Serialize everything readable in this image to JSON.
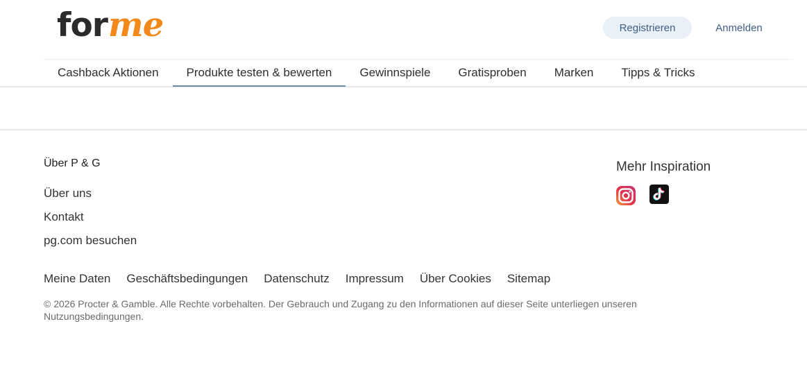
{
  "brand": {
    "logo_part1": "for",
    "logo_part2": "me",
    "logo_color_dark": "#2b2b2b",
    "logo_color_accent": "#f28a1b"
  },
  "header": {
    "register_label": "Registrieren",
    "login_label": "Anmelden",
    "accent_color": "#3f5e86"
  },
  "nav": {
    "items": [
      {
        "label": "Cashback Aktionen",
        "active": false
      },
      {
        "label": "Produkte testen & bewerten",
        "active": true
      },
      {
        "label": "Gewinnspiele",
        "active": false
      },
      {
        "label": "Gratisproben",
        "active": false
      },
      {
        "label": "Marken",
        "active": false
      },
      {
        "label": "Tipps & Tricks",
        "active": false
      }
    ]
  },
  "footer": {
    "heading": "Über P & G",
    "links": [
      "Über uns",
      "Kontakt",
      "pg.com besuchen"
    ],
    "inspiration_title": "Mehr Inspiration",
    "social": [
      {
        "icon": "instagram-icon"
      },
      {
        "icon": "tiktok-icon"
      }
    ],
    "bottom_links": [
      "Meine Daten",
      "Geschäftsbedingungen",
      "Datenschutz",
      "Impressum",
      "Über Cookies",
      "Sitemap"
    ],
    "copyright": "© 2026 Procter & Gamble. Alle Rechte vorbehalten. Der Gebrauch und Zugang zu den Informationen auf dieser Seite unterliegen unseren Nutzungsbedingungen."
  }
}
